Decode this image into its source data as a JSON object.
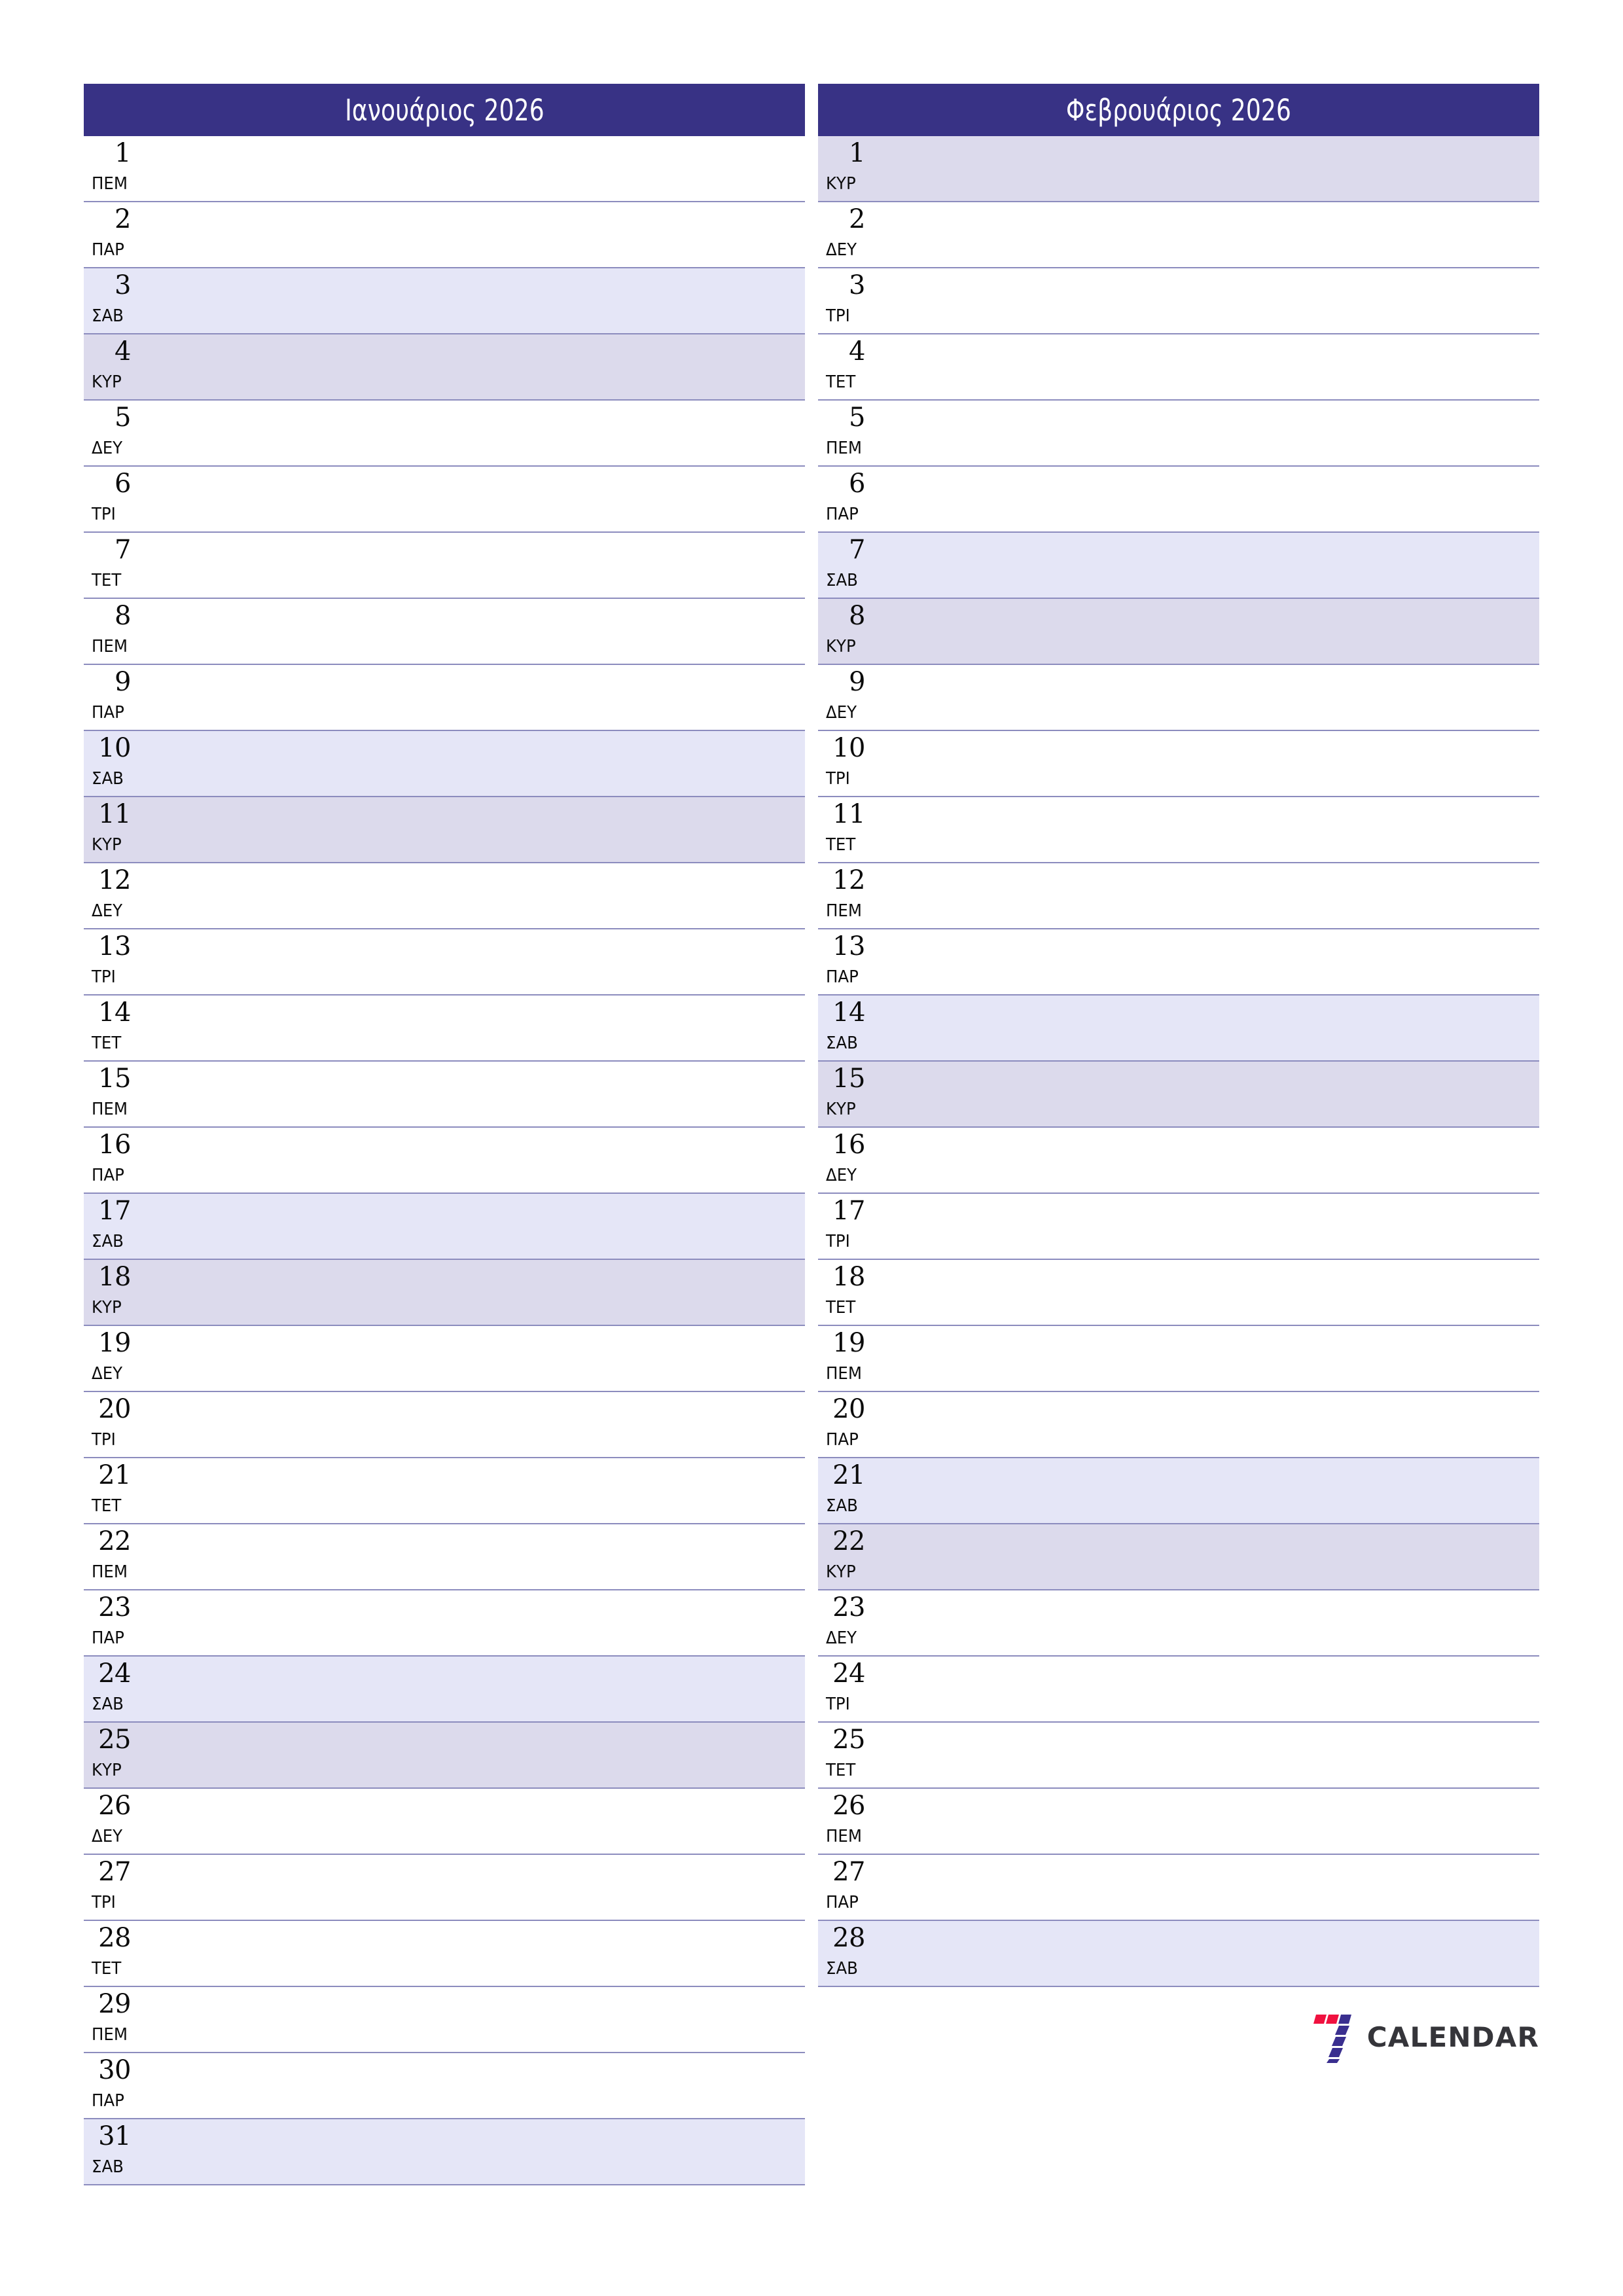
{
  "theme": {
    "header_bg": "#383285",
    "header_text": "#ffffff",
    "rule_color": "#8c8cbe",
    "saturday_bg": "#e5e6f7",
    "sunday_bg": "#dcdaec",
    "page_bg": "#ffffff",
    "logo_red": "#f0113f",
    "logo_blue": "#3a2f8f",
    "logo_word_color": "#35353a"
  },
  "brand": {
    "name": "CALENDAR",
    "mark": "seven-logo-icon"
  },
  "months": [
    {
      "title": "Ιανουάριος 2026",
      "name": "Ιανουάριος",
      "year": "2026",
      "days": [
        {
          "num": "1",
          "dow": "ΠΕΜ",
          "kind": "weekday"
        },
        {
          "num": "2",
          "dow": "ΠΑΡ",
          "kind": "weekday"
        },
        {
          "num": "3",
          "dow": "ΣΑΒ",
          "kind": "sat"
        },
        {
          "num": "4",
          "dow": "ΚΥΡ",
          "kind": "sun"
        },
        {
          "num": "5",
          "dow": "ΔΕΥ",
          "kind": "weekday"
        },
        {
          "num": "6",
          "dow": "ΤΡΙ",
          "kind": "weekday"
        },
        {
          "num": "7",
          "dow": "ΤΕΤ",
          "kind": "weekday"
        },
        {
          "num": "8",
          "dow": "ΠΕΜ",
          "kind": "weekday"
        },
        {
          "num": "9",
          "dow": "ΠΑΡ",
          "kind": "weekday"
        },
        {
          "num": "10",
          "dow": "ΣΑΒ",
          "kind": "sat"
        },
        {
          "num": "11",
          "dow": "ΚΥΡ",
          "kind": "sun"
        },
        {
          "num": "12",
          "dow": "ΔΕΥ",
          "kind": "weekday"
        },
        {
          "num": "13",
          "dow": "ΤΡΙ",
          "kind": "weekday"
        },
        {
          "num": "14",
          "dow": "ΤΕΤ",
          "kind": "weekday"
        },
        {
          "num": "15",
          "dow": "ΠΕΜ",
          "kind": "weekday"
        },
        {
          "num": "16",
          "dow": "ΠΑΡ",
          "kind": "weekday"
        },
        {
          "num": "17",
          "dow": "ΣΑΒ",
          "kind": "sat"
        },
        {
          "num": "18",
          "dow": "ΚΥΡ",
          "kind": "sun"
        },
        {
          "num": "19",
          "dow": "ΔΕΥ",
          "kind": "weekday"
        },
        {
          "num": "20",
          "dow": "ΤΡΙ",
          "kind": "weekday"
        },
        {
          "num": "21",
          "dow": "ΤΕΤ",
          "kind": "weekday"
        },
        {
          "num": "22",
          "dow": "ΠΕΜ",
          "kind": "weekday"
        },
        {
          "num": "23",
          "dow": "ΠΑΡ",
          "kind": "weekday"
        },
        {
          "num": "24",
          "dow": "ΣΑΒ",
          "kind": "sat"
        },
        {
          "num": "25",
          "dow": "ΚΥΡ",
          "kind": "sun"
        },
        {
          "num": "26",
          "dow": "ΔΕΥ",
          "kind": "weekday"
        },
        {
          "num": "27",
          "dow": "ΤΡΙ",
          "kind": "weekday"
        },
        {
          "num": "28",
          "dow": "ΤΕΤ",
          "kind": "weekday"
        },
        {
          "num": "29",
          "dow": "ΠΕΜ",
          "kind": "weekday"
        },
        {
          "num": "30",
          "dow": "ΠΑΡ",
          "kind": "weekday"
        },
        {
          "num": "31",
          "dow": "ΣΑΒ",
          "kind": "sat"
        }
      ]
    },
    {
      "title": "Φεβρουάριος 2026",
      "name": "Φεβρουάριος",
      "year": "2026",
      "days": [
        {
          "num": "1",
          "dow": "ΚΥΡ",
          "kind": "sun"
        },
        {
          "num": "2",
          "dow": "ΔΕΥ",
          "kind": "weekday"
        },
        {
          "num": "3",
          "dow": "ΤΡΙ",
          "kind": "weekday"
        },
        {
          "num": "4",
          "dow": "ΤΕΤ",
          "kind": "weekday"
        },
        {
          "num": "5",
          "dow": "ΠΕΜ",
          "kind": "weekday"
        },
        {
          "num": "6",
          "dow": "ΠΑΡ",
          "kind": "weekday"
        },
        {
          "num": "7",
          "dow": "ΣΑΒ",
          "kind": "sat"
        },
        {
          "num": "8",
          "dow": "ΚΥΡ",
          "kind": "sun"
        },
        {
          "num": "9",
          "dow": "ΔΕΥ",
          "kind": "weekday"
        },
        {
          "num": "10",
          "dow": "ΤΡΙ",
          "kind": "weekday"
        },
        {
          "num": "11",
          "dow": "ΤΕΤ",
          "kind": "weekday"
        },
        {
          "num": "12",
          "dow": "ΠΕΜ",
          "kind": "weekday"
        },
        {
          "num": "13",
          "dow": "ΠΑΡ",
          "kind": "weekday"
        },
        {
          "num": "14",
          "dow": "ΣΑΒ",
          "kind": "sat"
        },
        {
          "num": "15",
          "dow": "ΚΥΡ",
          "kind": "sun"
        },
        {
          "num": "16",
          "dow": "ΔΕΥ",
          "kind": "weekday"
        },
        {
          "num": "17",
          "dow": "ΤΡΙ",
          "kind": "weekday"
        },
        {
          "num": "18",
          "dow": "ΤΕΤ",
          "kind": "weekday"
        },
        {
          "num": "19",
          "dow": "ΠΕΜ",
          "kind": "weekday"
        },
        {
          "num": "20",
          "dow": "ΠΑΡ",
          "kind": "weekday"
        },
        {
          "num": "21",
          "dow": "ΣΑΒ",
          "kind": "sat"
        },
        {
          "num": "22",
          "dow": "ΚΥΡ",
          "kind": "sun"
        },
        {
          "num": "23",
          "dow": "ΔΕΥ",
          "kind": "weekday"
        },
        {
          "num": "24",
          "dow": "ΤΡΙ",
          "kind": "weekday"
        },
        {
          "num": "25",
          "dow": "ΤΕΤ",
          "kind": "weekday"
        },
        {
          "num": "26",
          "dow": "ΠΕΜ",
          "kind": "weekday"
        },
        {
          "num": "27",
          "dow": "ΠΑΡ",
          "kind": "weekday"
        },
        {
          "num": "28",
          "dow": "ΣΑΒ",
          "kind": "sat"
        }
      ]
    }
  ]
}
